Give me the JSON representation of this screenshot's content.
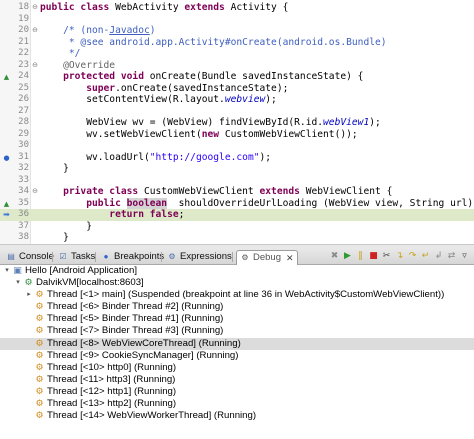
{
  "editor": {
    "lines": [
      {
        "num": "18",
        "fold": "⊖",
        "marker": "",
        "current": false,
        "segments": [
          [
            "kw",
            "public class "
          ],
          [
            "",
            "WebActivity "
          ],
          [
            "kw",
            "extends "
          ],
          [
            "",
            "Activity {"
          ]
        ]
      },
      {
        "num": "19",
        "fold": "",
        "marker": "",
        "current": false,
        "segments": [
          [
            "",
            ""
          ]
        ]
      },
      {
        "num": "20",
        "fold": "⊖",
        "marker": "",
        "current": false,
        "segments": [
          [
            "cmt",
            "    /* (non-"
          ],
          [
            "link",
            "Javadoc"
          ],
          [
            "cmt",
            ")"
          ]
        ]
      },
      {
        "num": "21",
        "fold": "",
        "marker": "",
        "current": false,
        "segments": [
          [
            "cmt",
            "     * @see android.app.Activity#onCreate(android.os.Bundle)"
          ]
        ]
      },
      {
        "num": "22",
        "fold": "",
        "marker": "",
        "current": false,
        "segments": [
          [
            "cmt",
            "     */"
          ]
        ]
      },
      {
        "num": "23",
        "fold": "⊖",
        "marker": "",
        "current": false,
        "segments": [
          [
            "ann",
            "    @Override"
          ]
        ]
      },
      {
        "num": "24",
        "fold": "",
        "marker": "override",
        "current": false,
        "segments": [
          [
            "kw",
            "    protected void "
          ],
          [
            "",
            "onCreate(Bundle savedInstanceState) {"
          ]
        ]
      },
      {
        "num": "25",
        "fold": "",
        "marker": "",
        "current": false,
        "segments": [
          [
            "kw",
            "        super"
          ],
          [
            "",
            ".onCreate(savedInstanceState);"
          ]
        ]
      },
      {
        "num": "26",
        "fold": "",
        "marker": "",
        "current": false,
        "segments": [
          [
            "",
            "        setContentView(R.layout."
          ],
          [
            "fld",
            "webview"
          ],
          [
            "",
            ");"
          ]
        ]
      },
      {
        "num": "27",
        "fold": "",
        "marker": "",
        "current": false,
        "segments": [
          [
            "",
            ""
          ]
        ]
      },
      {
        "num": "28",
        "fold": "",
        "marker": "",
        "current": false,
        "segments": [
          [
            "",
            "        WebView wv = (WebView) findViewById(R.id."
          ],
          [
            "fld",
            "webView1"
          ],
          [
            "",
            ");"
          ]
        ]
      },
      {
        "num": "29",
        "fold": "",
        "marker": "",
        "current": false,
        "segments": [
          [
            "",
            "        wv.setWebViewClient("
          ],
          [
            "kw",
            "new "
          ],
          [
            "",
            "CustomWebViewClient());"
          ]
        ]
      },
      {
        "num": "30",
        "fold": "",
        "marker": "",
        "current": false,
        "segments": [
          [
            "",
            ""
          ]
        ]
      },
      {
        "num": "31",
        "fold": "",
        "marker": "bp",
        "current": false,
        "segments": [
          [
            "",
            "        wv.loadUrl("
          ],
          [
            "str",
            "\"http://google.com\""
          ],
          [
            "",
            ");"
          ]
        ]
      },
      {
        "num": "32",
        "fold": "",
        "marker": "",
        "current": false,
        "segments": [
          [
            "",
            "    }"
          ]
        ]
      },
      {
        "num": "33",
        "fold": "",
        "marker": "",
        "current": false,
        "segments": [
          [
            "",
            ""
          ]
        ]
      },
      {
        "num": "34",
        "fold": "⊖",
        "marker": "",
        "current": false,
        "segments": [
          [
            "kw",
            "    private class "
          ],
          [
            "",
            "CustomWebViewClient "
          ],
          [
            "kw",
            "extends "
          ],
          [
            "",
            "WebViewClient {"
          ]
        ]
      },
      {
        "num": "35",
        "fold": "",
        "marker": "override",
        "current": false,
        "segments": [
          [
            "kw",
            "        public "
          ],
          [
            "kwhl",
            "boolean"
          ],
          [
            "",
            ""
          ],
          [
            "",
            "  shouldOverrideUrlLoading (WebView view, String url) {"
          ]
        ]
      },
      {
        "num": "36",
        "fold": "",
        "marker": "ip",
        "current": true,
        "segments": [
          [
            "kw",
            "            return false"
          ],
          [
            "",
            ";"
          ]
        ]
      },
      {
        "num": "37",
        "fold": "",
        "marker": "",
        "current": false,
        "segments": [
          [
            "",
            "        }"
          ]
        ]
      },
      {
        "num": "38",
        "fold": "",
        "marker": "",
        "current": false,
        "segments": [
          [
            "",
            "    }"
          ]
        ]
      }
    ]
  },
  "tabs": [
    {
      "id": "console",
      "label": "Console",
      "icon": "console-icon",
      "glyph": "▤",
      "active": false
    },
    {
      "id": "tasks",
      "label": "Tasks",
      "icon": "tasks-icon",
      "glyph": "☑",
      "active": false
    },
    {
      "id": "breakpoints",
      "label": "Breakpoints",
      "icon": "breakpoints-icon",
      "glyph": "●",
      "active": false
    },
    {
      "id": "expressions",
      "label": "Expressions",
      "icon": "expressions-icon",
      "glyph": "⚙",
      "active": false
    },
    {
      "id": "debug",
      "label": "Debug",
      "icon": "debug-icon",
      "glyph": "⚙",
      "active": true,
      "close": "✕"
    }
  ],
  "toolbar": [
    {
      "name": "remove-terminated-icon",
      "glyph": "✖",
      "color": "#8a8a8a"
    },
    {
      "name": "resume-icon",
      "glyph": "▶",
      "color": "#2f9a2f"
    },
    {
      "name": "suspend-icon",
      "glyph": "‖",
      "color": "#c7a21a"
    },
    {
      "name": "terminate-icon",
      "glyph": "■",
      "color": "#cc2222"
    },
    {
      "name": "disconnect-icon",
      "glyph": "✂",
      "color": "#444444"
    },
    {
      "name": "step-into-icon",
      "glyph": "↴",
      "color": "#c7a21a"
    },
    {
      "name": "step-over-icon",
      "glyph": "↷",
      "color": "#c7a21a"
    },
    {
      "name": "step-return-icon",
      "glyph": "↵",
      "color": "#c7a21a"
    },
    {
      "name": "drop-to-frame-icon",
      "glyph": "↲",
      "color": "#888888"
    },
    {
      "name": "step-filters-icon",
      "glyph": "⇄",
      "color": "#888888"
    },
    {
      "name": "view-menu-icon",
      "glyph": "▿",
      "color": "#444444"
    }
  ],
  "debug_tree": [
    {
      "depth": 0,
      "twisty": "▾",
      "icon": "application-icon",
      "glyph": "▣",
      "label": "Hello [Android Application]",
      "selected": false
    },
    {
      "depth": 1,
      "twisty": "▾",
      "icon": "vm-icon",
      "glyph": "⚙",
      "label": "DalvikVM[localhost:8603]",
      "selected": false
    },
    {
      "depth": 2,
      "twisty": "▸",
      "icon": "thread-suspended-icon",
      "glyph": "⚙",
      "label": "Thread [<1> main] (Suspended (breakpoint at line 36 in WebActivity$CustomWebViewClient))",
      "selected": false
    },
    {
      "depth": 2,
      "twisty": "",
      "icon": "thread-running-icon",
      "glyph": "⚙",
      "label": "Thread [<6> Binder Thread #2] (Running)",
      "selected": false
    },
    {
      "depth": 2,
      "twisty": "",
      "icon": "thread-running-icon",
      "glyph": "⚙",
      "label": "Thread [<5> Binder Thread #1] (Running)",
      "selected": false
    },
    {
      "depth": 2,
      "twisty": "",
      "icon": "thread-running-icon",
      "glyph": "⚙",
      "label": "Thread [<7> Binder Thread #3] (Running)",
      "selected": false
    },
    {
      "depth": 2,
      "twisty": "",
      "icon": "thread-running-icon",
      "glyph": "⚙",
      "label": "Thread [<8> WebViewCoreThread] (Running)",
      "selected": true
    },
    {
      "depth": 2,
      "twisty": "",
      "icon": "thread-running-icon",
      "glyph": "⚙",
      "label": "Thread [<9> CookieSyncManager] (Running)",
      "selected": false
    },
    {
      "depth": 2,
      "twisty": "",
      "icon": "thread-running-icon",
      "glyph": "⚙",
      "label": "Thread [<10> http0] (Running)",
      "selected": false
    },
    {
      "depth": 2,
      "twisty": "",
      "icon": "thread-running-icon",
      "glyph": "⚙",
      "label": "Thread [<11> http3] (Running)",
      "selected": false
    },
    {
      "depth": 2,
      "twisty": "",
      "icon": "thread-running-icon",
      "glyph": "⚙",
      "label": "Thread [<12> http1] (Running)",
      "selected": false
    },
    {
      "depth": 2,
      "twisty": "",
      "icon": "thread-running-icon",
      "glyph": "⚙",
      "label": "Thread [<13> http2] (Running)",
      "selected": false
    },
    {
      "depth": 2,
      "twisty": "",
      "icon": "thread-running-icon",
      "glyph": "⚙",
      "label": "Thread [<14> WebViewWorkerThread] (Running)",
      "selected": false
    }
  ]
}
